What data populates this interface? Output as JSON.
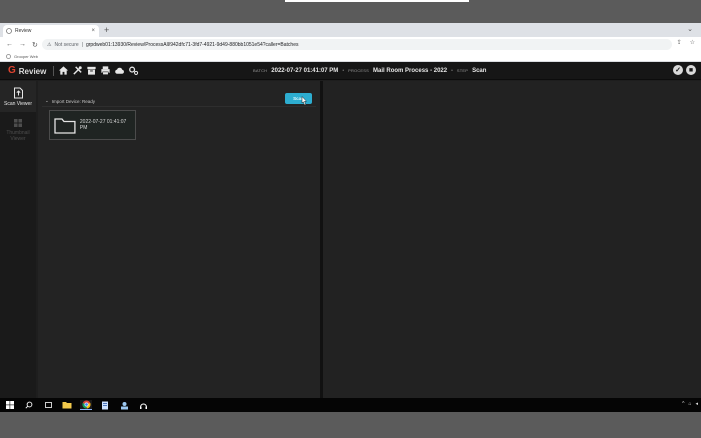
{
  "browser": {
    "tab_title": "Review",
    "tab_close": "×",
    "new_tab": "+",
    "tab_menu": "⌄",
    "security_label": "Not secure",
    "url": "grpdweb01:13930/Review/ProcessAll/942dfc71-3fd7-4921-9d49-880bb1051e54?caller=Batches",
    "bookmark": "Grooper Web"
  },
  "app": {
    "brand": "Review",
    "batch_label": "BATCH",
    "batch_value": "2022-07-27 01:41:07 PM",
    "process_label": "PROCESS",
    "process_value": "Mail Room Process - 2022",
    "step_label": "STEP",
    "step_value": "Scan"
  },
  "sidebar": {
    "items": [
      {
        "label": "Scan Viewer",
        "icon": "scan-viewer-icon",
        "active": true
      },
      {
        "label": "Thumbnail Viewer",
        "icon": "thumbnail-viewer-icon",
        "active": false
      }
    ]
  },
  "scan_panel": {
    "device_status": "Import Device: Ready",
    "scan_button": "Scan",
    "batch_card_label": "2022-07-27 01:41:07 PM"
  },
  "colors": {
    "accent": "#2dadd0",
    "brand": "#e0432f",
    "app_bg": "#1e1e1e"
  }
}
